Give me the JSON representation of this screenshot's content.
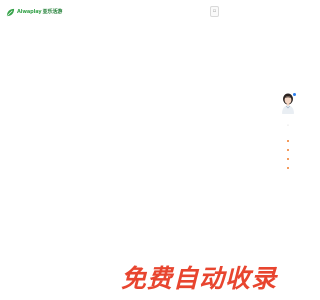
{
  "header": {
    "logo": {
      "icon": "alvaplay-leaf-logo-icon",
      "brand_text": "Alwaplay",
      "cn_text": "亚乐活游",
      "brand_color": "#35a249"
    },
    "top_box_icon": "box-icon"
  },
  "float_bar": {
    "avatar_icon": "avatar-photo",
    "status_dot_color": "#2f80ed",
    "small_icon": "small-mark-icon",
    "bullet_color": "#f07b2a"
  },
  "banner": {
    "text": "免费自动收录",
    "color": "#e8452f"
  }
}
